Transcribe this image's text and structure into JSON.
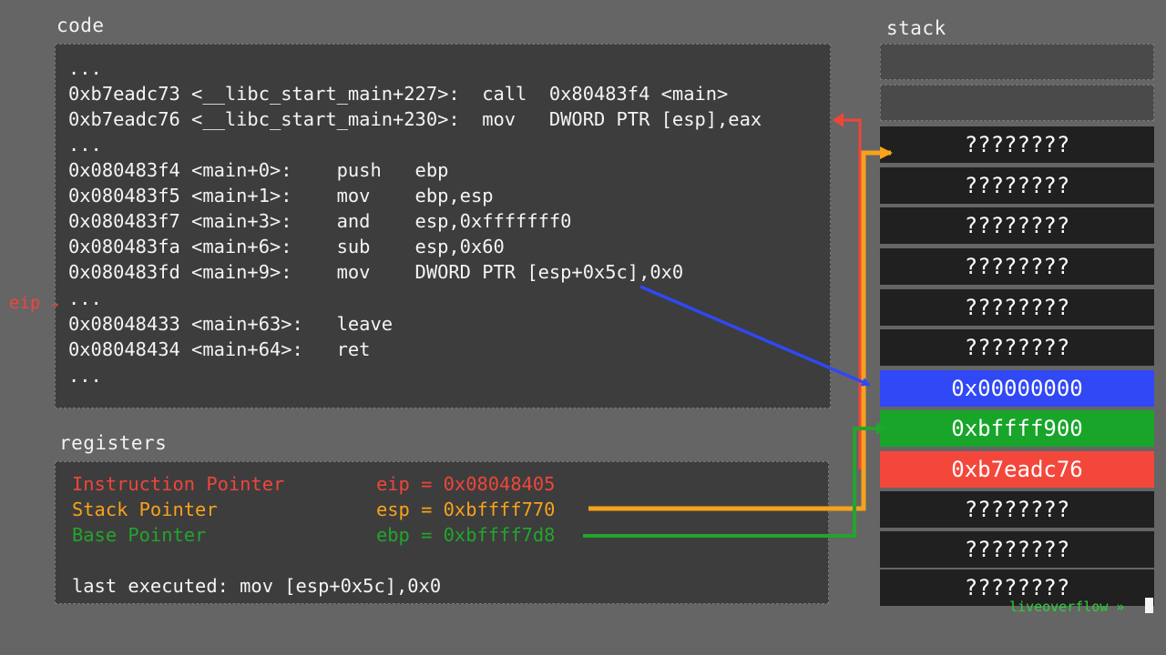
{
  "code_title": "code",
  "registers_title": "registers",
  "stack_title": "stack",
  "code_lines": [
    "...",
    "0xb7eadc73 <__libc_start_main+227>:  call  0x80483f4 <main>",
    "0xb7eadc76 <__libc_start_main+230>:  mov   DWORD PTR [esp],eax",
    "...",
    "0x080483f4 <main+0>:    push   ebp",
    "0x080483f5 <main+1>:    mov    ebp,esp",
    "0x080483f7 <main+3>:    and    esp,0xfffffff0",
    "0x080483fa <main+6>:    sub    esp,0x60",
    "0x080483fd <main+9>:    mov    DWORD PTR [esp+0x5c],0x0",
    "...",
    "0x08048433 <main+63>:   leave",
    "0x08048434 <main+64>:   ret",
    "..."
  ],
  "eip_label": "eip",
  "eip_arrow": "→",
  "registers": {
    "eip": {
      "name": "Instruction Pointer",
      "value": "eip = 0x08048405",
      "color": "#f0453a"
    },
    "esp": {
      "name": "Stack Pointer",
      "value": "esp = 0xbffff770",
      "color": "#f7a21b"
    },
    "ebp": {
      "name": "Base Pointer",
      "value": "ebp = 0xbffff7d8",
      "color": "#22a52c"
    },
    "last_executed": "last executed: mov [esp+0x5c],0x0"
  },
  "stack_cells": [
    {
      "value": "",
      "kind": "empty"
    },
    {
      "value": "",
      "kind": "empty"
    },
    {
      "value": "????????",
      "kind": "unknown"
    },
    {
      "value": "????????",
      "kind": "unknown"
    },
    {
      "value": "????????",
      "kind": "unknown"
    },
    {
      "value": "????????",
      "kind": "unknown"
    },
    {
      "value": "????????",
      "kind": "unknown"
    },
    {
      "value": "????????",
      "kind": "unknown"
    },
    {
      "value": "0x00000000",
      "kind": "local-var",
      "color": "#3048f5"
    },
    {
      "value": "0xbffff900",
      "kind": "saved-ebp",
      "color": "#18a52a"
    },
    {
      "value": "0xb7eadc76",
      "kind": "return-address",
      "color": "#f4473c"
    },
    {
      "value": "????????",
      "kind": "unknown"
    },
    {
      "value": "????????",
      "kind": "unknown"
    },
    {
      "value": "????????",
      "kind": "unknown"
    }
  ],
  "watermark": "liveoverflow »",
  "colors": {
    "background": "#656565",
    "panel": "#3d3d3d",
    "eip": "#f0453a",
    "esp": "#f7a21b",
    "ebp": "#22a52c",
    "write_arrow": "#3048f5"
  }
}
